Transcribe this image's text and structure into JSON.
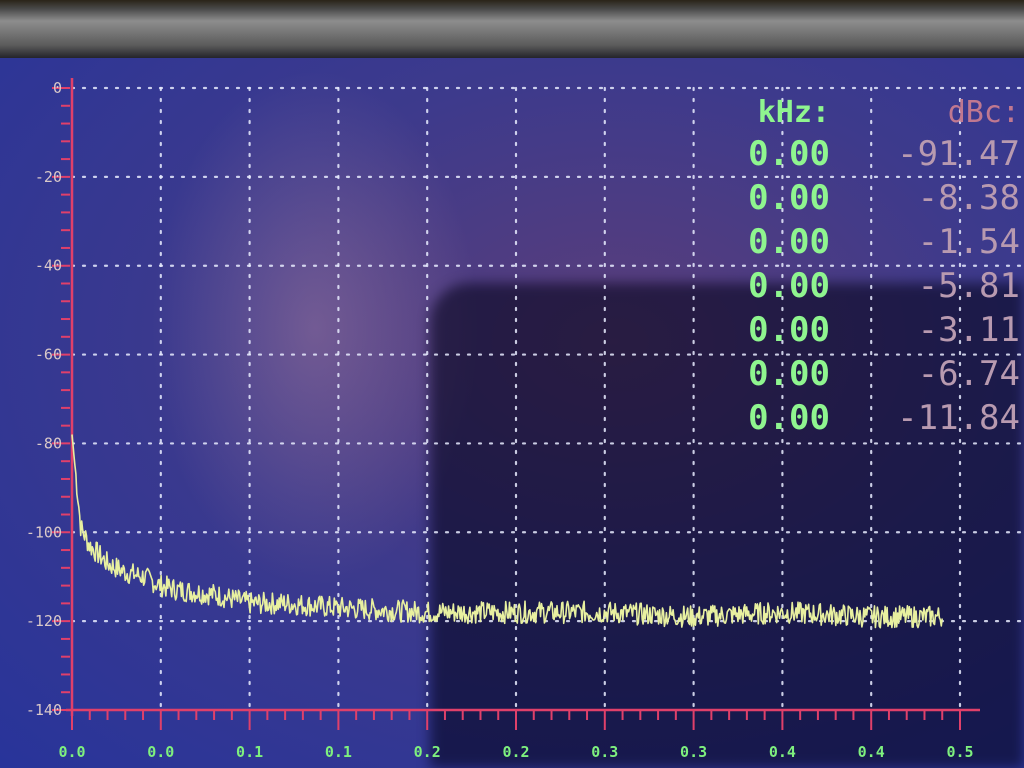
{
  "readout": {
    "khz_header": "kHz:",
    "dbc_header": "dBc:",
    "rows": [
      {
        "khz": "0.00",
        "dbc": "-91.47"
      },
      {
        "khz": "0.00",
        "dbc": "-8.38"
      },
      {
        "khz": "0.00",
        "dbc": "-1.54"
      },
      {
        "khz": "0.00",
        "dbc": "-5.81"
      },
      {
        "khz": "0.00",
        "dbc": "-3.11"
      },
      {
        "khz": "0.00",
        "dbc": "-6.74"
      },
      {
        "khz": "0.00",
        "dbc": "-11.84"
      }
    ]
  },
  "chart_data": {
    "type": "line",
    "y_tick_labels": [
      "0",
      "-20",
      "-40",
      "-60",
      "-80",
      "-100",
      "-120",
      "-140"
    ],
    "x_tick_labels": [
      "0.0",
      "0.0",
      "0.1",
      "0.1",
      "0.2",
      "0.2",
      "0.3",
      "0.3",
      "0.4",
      "0.4",
      "0.5"
    ],
    "ylim": [
      -140,
      0
    ],
    "xlim": [
      0,
      0.5
    ],
    "grid": true,
    "series": [
      {
        "color": "#e8f0a0",
        "x": [
          0.0,
          0.005,
          0.01,
          0.02,
          0.03,
          0.04,
          0.05,
          0.06,
          0.08,
          0.1,
          0.12,
          0.15,
          0.2,
          0.25,
          0.3,
          0.35,
          0.4,
          0.45,
          0.49
        ],
        "y": [
          -78,
          -99,
          -103,
          -107,
          -109,
          -110,
          -112,
          -113,
          -114,
          -116,
          -116,
          -117,
          -118,
          -118,
          -118,
          -119,
          -118,
          -119,
          -119
        ]
      }
    ],
    "colors": {
      "axis": "#e0406a",
      "grid": "#e8ecff",
      "trace": "#e8f0a0",
      "x_labels": "#7ef07e",
      "y_labels": "#d9c9c9"
    }
  }
}
